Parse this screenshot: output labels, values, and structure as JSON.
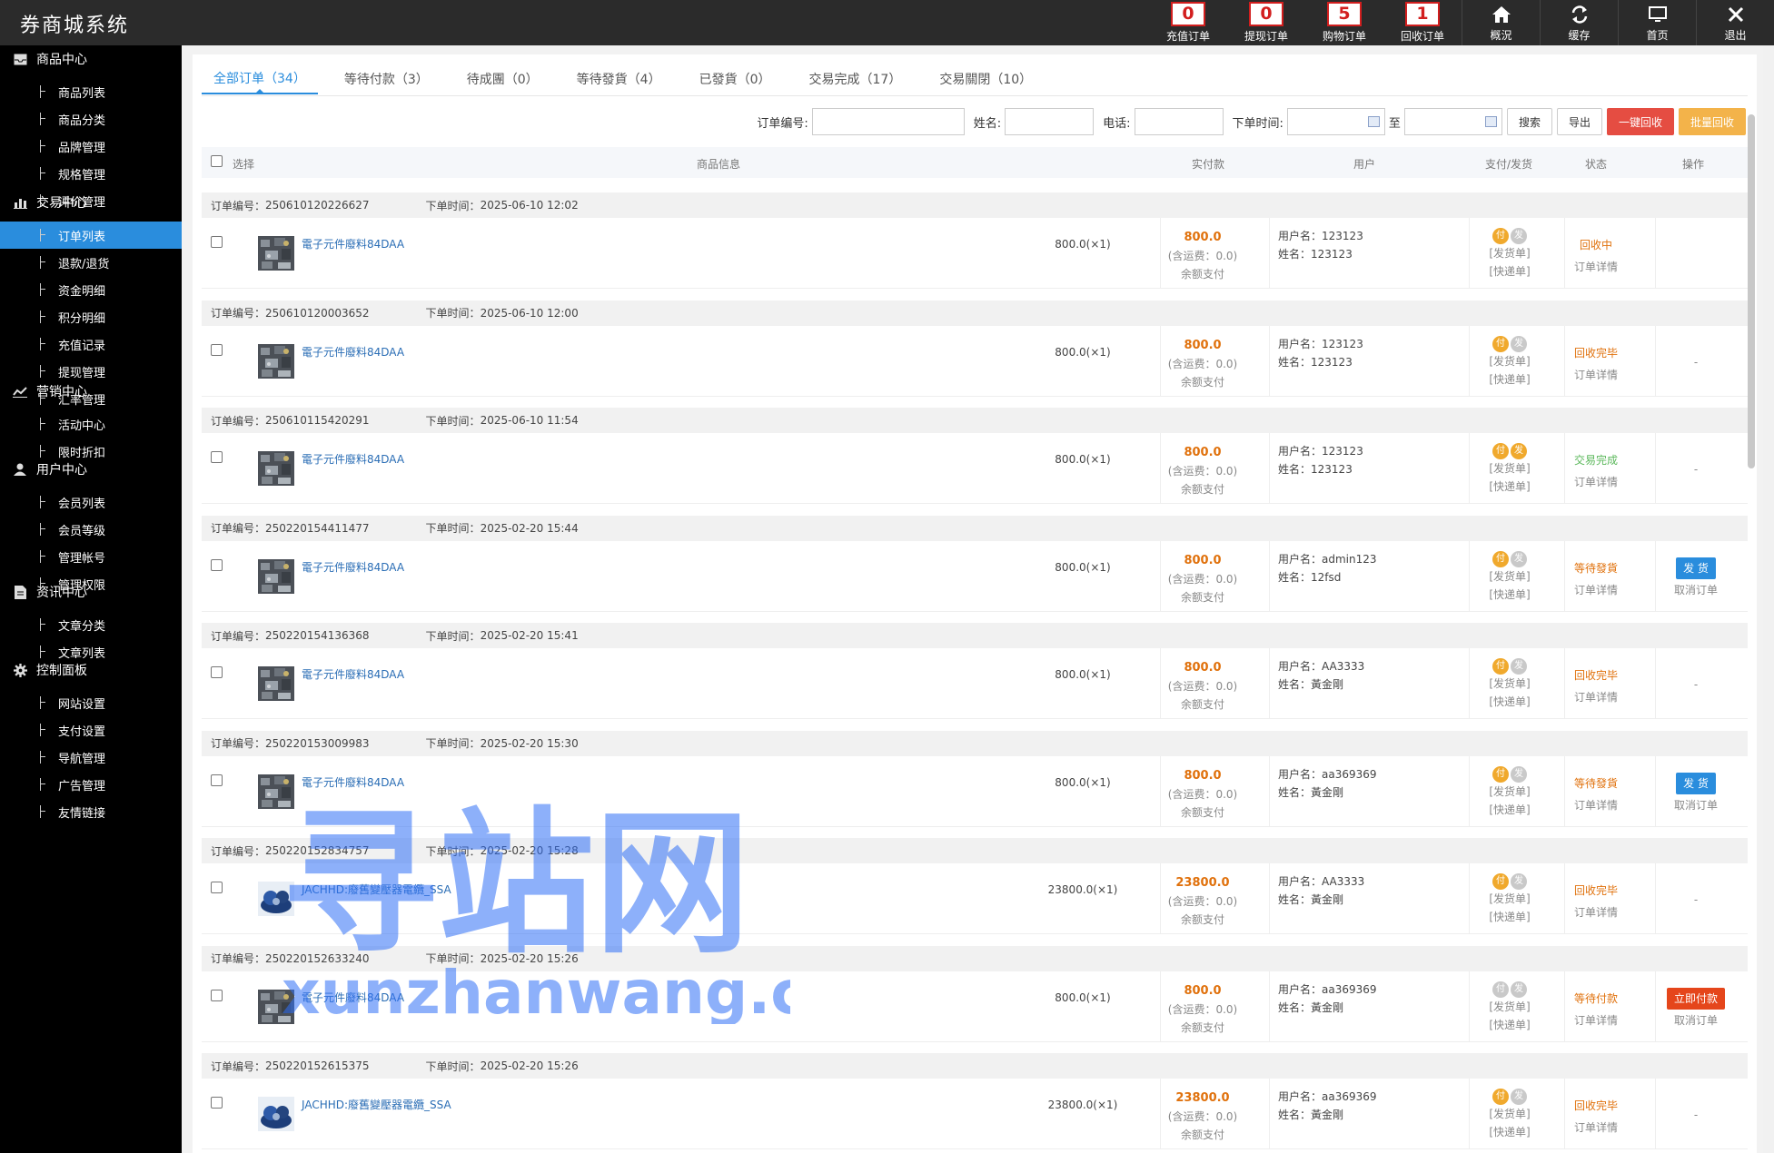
{
  "app": {
    "title": "券商城系统"
  },
  "top_nav": [
    {
      "badge": "0",
      "label": "充值订单"
    },
    {
      "badge": "0",
      "label": "提现订单"
    },
    {
      "badge": "5",
      "label": "购物订单"
    },
    {
      "badge": "1",
      "label": "回收订单"
    },
    {
      "icon": "home-icon",
      "label": "概況"
    },
    {
      "icon": "refresh-icon",
      "label": "缓存"
    },
    {
      "icon": "monitor-icon",
      "label": "首页"
    },
    {
      "icon": "close-icon",
      "label": "退出"
    }
  ],
  "sidebar": {
    "sections": [
      {
        "title": "商品中心",
        "icon": "inbox-icon",
        "items": [
          "商品列表",
          "商品分类",
          "品牌管理",
          "规格管理",
          "评价管理"
        ]
      },
      {
        "title": "交易中心",
        "icon": "bar-chart-icon",
        "items": [
          "订单列表",
          "退款/退货",
          "资金明细",
          "积分明细",
          "充值记录",
          "提现管理",
          "汇率管理"
        ]
      },
      {
        "title": "营销中心",
        "icon": "line-chart-icon",
        "items": [
          "活动中心",
          "限时折扣"
        ]
      },
      {
        "title": "用户中心",
        "icon": "user-icon",
        "items": [
          "会员列表",
          "会员等级",
          "管理帐号",
          "管理权限"
        ]
      },
      {
        "title": "资讯中心",
        "icon": "file-icon",
        "items": [
          "文章分类",
          "文章列表"
        ]
      },
      {
        "title": "控制面板",
        "icon": "gear-icon",
        "items": [
          "网站设置",
          "支付设置",
          "导航管理",
          "广告管理",
          "友情链接"
        ]
      }
    ],
    "active": "订单列表"
  },
  "tabs": [
    {
      "label": "全部订单（34）",
      "active": true
    },
    {
      "label": "等待付款（3）"
    },
    {
      "label": "待成團（0）"
    },
    {
      "label": "等待發貨（4）"
    },
    {
      "label": "已發貨（0）"
    },
    {
      "label": "交易完成（17）"
    },
    {
      "label": "交易關閉（10）"
    }
  ],
  "filters": {
    "order_no_label": "订单编号:",
    "name_label": "姓名:",
    "phone_label": "电话:",
    "time_label": "下单时间:",
    "to_label": "至",
    "search_btn": "搜索",
    "export_btn": "导出",
    "recycle_btn": "一键回收",
    "batch_btn": "批量回收"
  },
  "table_header": {
    "select": "选择",
    "product": "商品信息",
    "paid": "实付款",
    "user": "用户",
    "pay_ship": "支付/发货",
    "status": "状态",
    "ops": "操作"
  },
  "labels": {
    "order_no": "订单编号：",
    "order_time": "下单时间：",
    "username": "用户名：",
    "realname": "姓名：",
    "freight": "(含运费：0.0)",
    "balance": "余额支付",
    "ship_doc": "[发货单]",
    "express_doc": "[快递单]",
    "detail": "订单详情",
    "pay_dot": "付",
    "ship_dot": "发"
  },
  "orders": [
    {
      "no": "250610120226627",
      "time": "2025-06-10 12:02",
      "product": "電子元件廢料84DAA",
      "qty": "800.0(×1)",
      "amount": "800.0",
      "username": "123123",
      "name": "123123",
      "paid": true,
      "shipped": false,
      "status": "回收中",
      "status_color": "#e0710c",
      "op": "",
      "op_sub": ""
    },
    {
      "no": "250610120003652",
      "time": "2025-06-10 12:00",
      "product": "電子元件廢料84DAA",
      "qty": "800.0(×1)",
      "amount": "800.0",
      "username": "123123",
      "name": "123123",
      "paid": true,
      "shipped": false,
      "status": "回收完毕",
      "status_color": "#e0710c",
      "op": "-",
      "op_sub": ""
    },
    {
      "no": "250610115420291",
      "time": "2025-06-10 11:54",
      "product": "電子元件廢料84DAA",
      "qty": "800.0(×1)",
      "amount": "800.0",
      "username": "123123",
      "name": "123123",
      "paid": true,
      "shipped": true,
      "status": "交易完成",
      "status_color": "#5cb85c",
      "op": "-",
      "op_sub": ""
    },
    {
      "no": "250220154411477",
      "time": "2025-02-20 15:44",
      "product": "電子元件廢料84DAA",
      "qty": "800.0(×1)",
      "amount": "800.0",
      "username": "admin123",
      "name": "12fsd",
      "paid": true,
      "shipped": false,
      "status": "等待發貨",
      "status_color": "#e0710c",
      "op": "发 货",
      "op_style": "blue",
      "op_sub": "取消订单"
    },
    {
      "no": "250220154136368",
      "time": "2025-02-20 15:41",
      "product": "電子元件廢料84DAA",
      "qty": "800.0(×1)",
      "amount": "800.0",
      "username": "AA3333",
      "name": "黃金剛",
      "paid": true,
      "shipped": false,
      "status": "回收完毕",
      "status_color": "#e0710c",
      "op": "-",
      "op_sub": ""
    },
    {
      "no": "250220153009983",
      "time": "2025-02-20 15:30",
      "product": "電子元件廢料84DAA",
      "qty": "800.0(×1)",
      "amount": "800.0",
      "username": "aa369369",
      "name": "黃金剛",
      "paid": true,
      "shipped": false,
      "status": "等待發貨",
      "status_color": "#e0710c",
      "op": "发 货",
      "op_style": "blue",
      "op_sub": "取消订单"
    },
    {
      "no": "250220152834757",
      "time": "2025-02-20 15:28",
      "product": "JACHHD:廢舊變壓器電纜_SSA",
      "qty": "23800.0(×1)",
      "amount": "23800.0",
      "username": "AA3333",
      "name": "黃金剛",
      "paid": true,
      "shipped": false,
      "status": "回收完毕",
      "status_color": "#e0710c",
      "op": "-",
      "op_sub": ""
    },
    {
      "no": "250220152633240",
      "time": "2025-02-20 15:26",
      "product": "電子元件廢料84DAA",
      "qty": "800.0(×1)",
      "amount": "800.0",
      "username": "aa369369",
      "name": "黃金剛",
      "paid": false,
      "shipped": false,
      "status": "等待付款",
      "status_color": "#e0710c",
      "op": "立即付款",
      "op_style": "red",
      "op_sub": "取消订单"
    },
    {
      "no": "250220152615375",
      "time": "2025-02-20 15:26",
      "product": "JACHHD:廢舊變壓器電纜_SSA",
      "qty": "23800.0(×1)",
      "amount": "23800.0",
      "username": "aa369369",
      "name": "黃金剛",
      "paid": true,
      "shipped": false,
      "status": "回收完毕",
      "status_color": "#e0710c",
      "op": "-",
      "op_sub": ""
    }
  ],
  "watermark": {
    "line1": "寻站网",
    "line2": "xunzhanwang.com"
  }
}
